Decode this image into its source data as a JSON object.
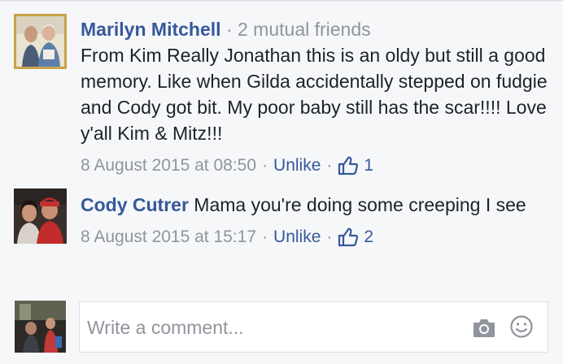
{
  "comments": [
    {
      "author": "Marilyn Mitchell",
      "separator": "·",
      "mutual": "2 mutual friends",
      "text": "From Kim Really Jonathan this is an oldy but still a good memory. Like when Gilda accidentally stepped on fudgie and Cody got bit. My poor baby still has the scar!!!! Love y'all Kim & Mitz!!!",
      "timestamp": "8 August 2015 at 08:50",
      "dot": "·",
      "action": "Unlike",
      "dot2": "·",
      "likes": "1"
    },
    {
      "author": "Cody Cutrer",
      "text": "Mama you're doing some creeping I see",
      "timestamp": "8 August 2015 at 15:17",
      "dot": "·",
      "action": "Unlike",
      "dot2": "·",
      "likes": "2"
    }
  ],
  "composer": {
    "placeholder": "Write a comment..."
  },
  "icons": {
    "like": "thumbs-up-icon",
    "camera": "camera-icon",
    "emoji": "smiley-icon"
  },
  "colors": {
    "link": "#365899",
    "meta": "#90949c",
    "text": "#1d2129",
    "background": "#f6f7f9"
  }
}
